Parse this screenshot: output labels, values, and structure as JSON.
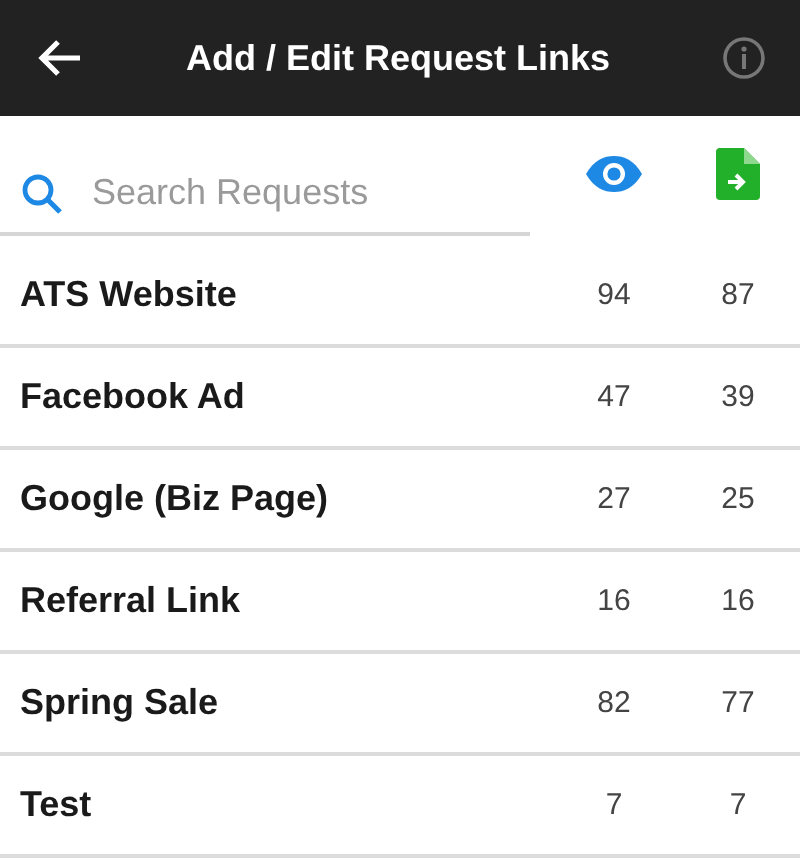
{
  "app_bar": {
    "title": "Add / Edit Request Links"
  },
  "search": {
    "placeholder": "Search Requests"
  },
  "rows": [
    {
      "name": "ATS Website",
      "views": "94",
      "submissions": "87"
    },
    {
      "name": "Facebook Ad",
      "views": "47",
      "submissions": "39"
    },
    {
      "name": "Google (Biz Page)",
      "views": "27",
      "submissions": "25"
    },
    {
      "name": "Referral Link",
      "views": "16",
      "submissions": "16"
    },
    {
      "name": "Spring Sale",
      "views": "82",
      "submissions": "77"
    },
    {
      "name": "Test",
      "views": "7",
      "submissions": "7"
    }
  ]
}
